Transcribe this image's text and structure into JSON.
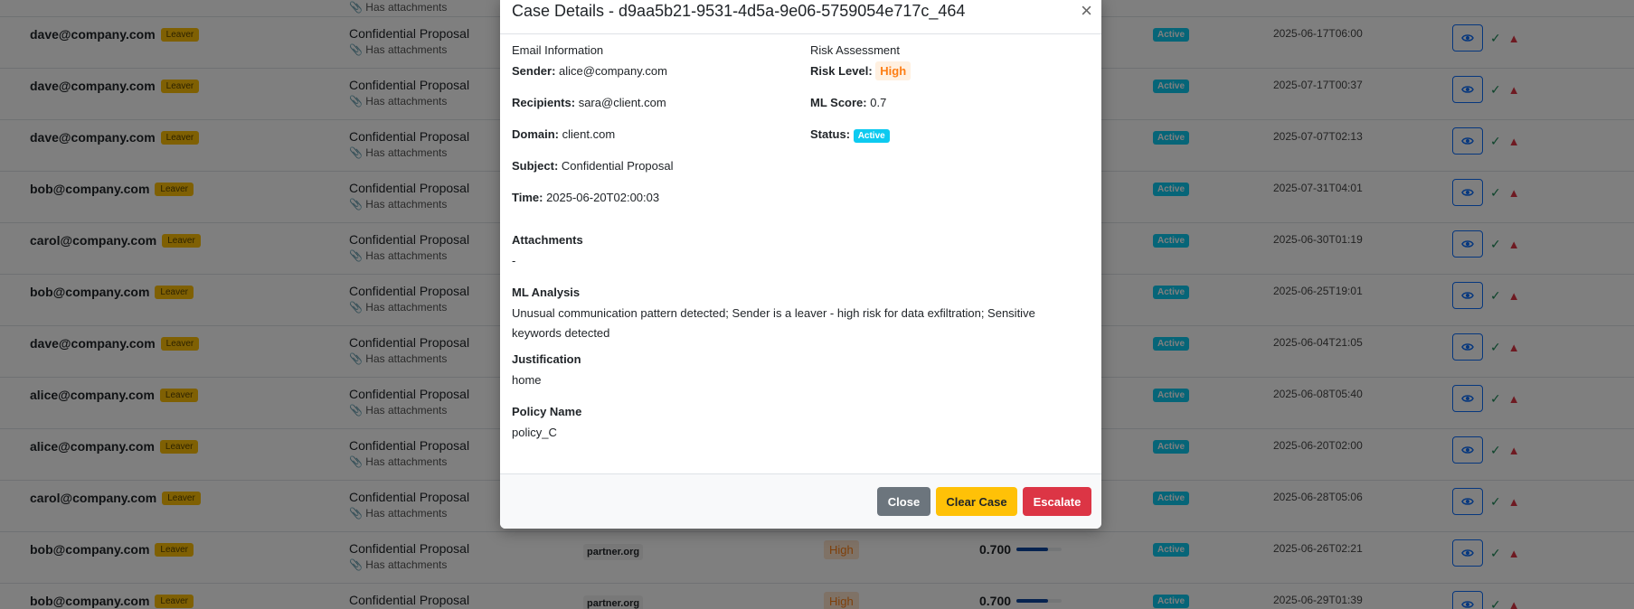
{
  "table": {
    "has_attachments_label": "Has attachments",
    "leaver_label": "Leaver",
    "rows": [
      {
        "sender": "",
        "subject": "",
        "domain": "",
        "risk": "",
        "score": "",
        "status": "",
        "time": "",
        "partial_label": "Has attachments"
      },
      {
        "sender": "dave@company.com",
        "subject": "Confidential Proposal",
        "domain": "",
        "risk": "",
        "score": "",
        "status": "Active",
        "time": "2025-06-17T06:00"
      },
      {
        "sender": "dave@company.com",
        "subject": "Confidential Proposal",
        "domain": "",
        "risk": "",
        "score": "",
        "status": "Active",
        "time": "2025-07-17T00:37"
      },
      {
        "sender": "dave@company.com",
        "subject": "Confidential Proposal",
        "domain": "",
        "risk": "",
        "score": "",
        "status": "Active",
        "time": "2025-07-07T02:13"
      },
      {
        "sender": "bob@company.com",
        "subject": "Confidential Proposal",
        "domain": "",
        "risk": "",
        "score": "",
        "status": "Active",
        "time": "2025-07-31T04:01"
      },
      {
        "sender": "carol@company.com",
        "subject": "Confidential Proposal",
        "domain": "",
        "risk": "",
        "score": "",
        "status": "Active",
        "time": "2025-06-30T01:19"
      },
      {
        "sender": "bob@company.com",
        "subject": "Confidential Proposal",
        "domain": "",
        "risk": "",
        "score": "",
        "status": "Active",
        "time": "2025-06-25T19:01"
      },
      {
        "sender": "dave@company.com",
        "subject": "Confidential Proposal",
        "domain": "",
        "risk": "",
        "score": "",
        "status": "Active",
        "time": "2025-06-04T21:05"
      },
      {
        "sender": "alice@company.com",
        "subject": "Confidential Proposal",
        "domain": "",
        "risk": "",
        "score": "",
        "status": "Active",
        "time": "2025-06-08T05:40"
      },
      {
        "sender": "alice@company.com",
        "subject": "Confidential Proposal",
        "domain": "",
        "risk": "",
        "score": "",
        "status": "Active",
        "time": "2025-06-20T02:00"
      },
      {
        "sender": "carol@company.com",
        "subject": "Confidential Proposal",
        "domain": "",
        "risk": "",
        "score": "",
        "status": "Active",
        "time": "2025-06-28T05:06"
      },
      {
        "sender": "bob@company.com",
        "subject": "Confidential Proposal",
        "domain": "partner.org",
        "risk": "High",
        "score": "0.700",
        "score_fraction": 0.7,
        "status": "Active",
        "time": "2025-06-26T02:21"
      },
      {
        "sender": "bob@company.com",
        "subject": "Confidential Proposal",
        "domain": "partner.org",
        "risk": "High",
        "score": "0.700",
        "score_fraction": 0.7,
        "status": "Active",
        "time": "2025-06-29T01:39"
      }
    ]
  },
  "modal": {
    "title": "Case Details - d9aa5b21-9531-4d5a-9e06-5759054e717c_464",
    "close_icon": "×",
    "email_info_heading": "Email Information",
    "risk_heading": "Risk Assessment",
    "sender_label": "Sender:",
    "sender": "alice@company.com",
    "recipients_label": "Recipients:",
    "recipients": "sara@client.com",
    "domain_label": "Domain:",
    "domain": "client.com",
    "subject_label": "Subject:",
    "subject": "Confidential Proposal",
    "time_label": "Time:",
    "time": "2025-06-20T02:00:03",
    "risk_level_label": "Risk Level:",
    "risk_level": "High",
    "ml_score_label": "ML Score:",
    "ml_score": "0.7",
    "status_label": "Status:",
    "status": "Active",
    "attachments_label": "Attachments",
    "attachments": "-",
    "ml_analysis_label": "ML Analysis",
    "ml_analysis": "Unusual communication pattern detected; Sender is a leaver - high risk for data exfiltration; Sensitive keywords detected",
    "justification_label": "Justification",
    "justification": "home",
    "policy_label": "Policy Name",
    "policy": "policy_C",
    "buttons": {
      "close": "Close",
      "clear": "Clear Case",
      "escalate": "Escalate"
    }
  },
  "colors": {
    "accent": "#0d6efd",
    "warning": "#ffc107",
    "danger": "#dc3545",
    "info": "#0dcaf0",
    "risk_high": "#fd7e14"
  }
}
